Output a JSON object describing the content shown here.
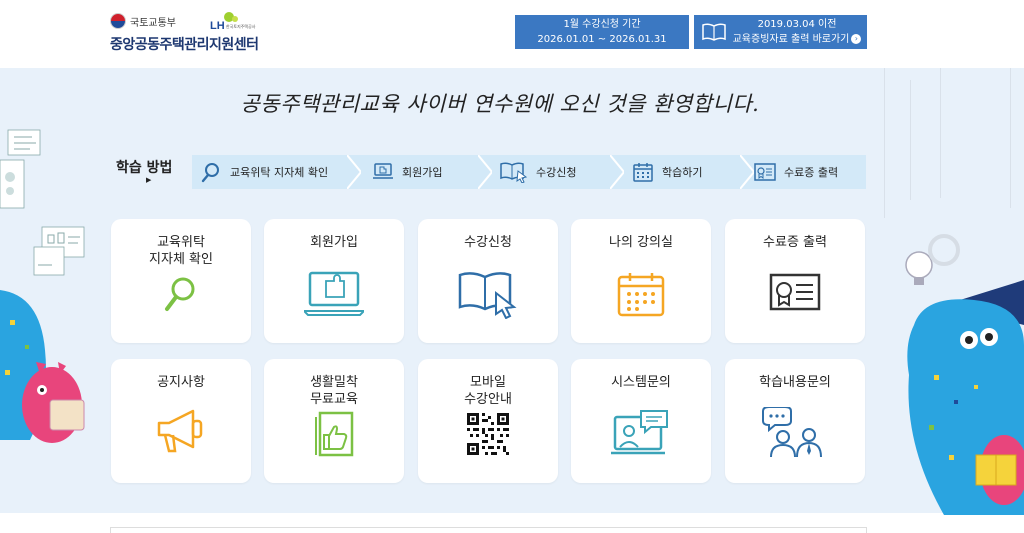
{
  "header": {
    "ministry": "국토교통부",
    "lh_logo": "LH",
    "lh_sub": "한국토지주택공사",
    "center_name": "중앙공동주택관리지원센터",
    "period_button": {
      "line1": "1월 수강신청 기간",
      "line2": "2026.01.01 ~ 2026.01.31"
    },
    "cert_button": {
      "line1": "2019.03.04 이전",
      "line2": "교육증빙자료 출력 바로가기",
      "icon": "book-icon"
    }
  },
  "welcome": "공동주택관리교육 사이버 연수원에 오신 것을 환영합니다.",
  "study": {
    "label": "학습 방법",
    "steps": [
      {
        "label": "교육위탁 지자체 확인",
        "icon": "search-icon"
      },
      {
        "label": "회원가입",
        "icon": "laptop-puzzle-icon"
      },
      {
        "label": "수강신청",
        "icon": "book-cursor-icon"
      },
      {
        "label": "학습하기",
        "icon": "calendar-icon"
      },
      {
        "label": "수료증 출력",
        "icon": "certificate-icon"
      }
    ]
  },
  "cards": [
    {
      "title": "교육위탁\n지자체 확인",
      "icon": "search-icon"
    },
    {
      "title": "회원가입",
      "icon": "laptop-puzzle-icon"
    },
    {
      "title": "수강신청",
      "icon": "book-cursor-icon"
    },
    {
      "title": "나의 강의실",
      "icon": "calendar-icon"
    },
    {
      "title": "수료증 출력",
      "icon": "certificate-icon"
    },
    {
      "title": "공지사항",
      "icon": "megaphone-icon"
    },
    {
      "title": "생활밀착\n무료교육",
      "icon": "book-thumbs-up-icon"
    },
    {
      "title": "모바일\n수강안내",
      "icon": "qr-code-icon"
    },
    {
      "title": "시스템문의",
      "icon": "monitor-chat-icon"
    },
    {
      "title": "학습내용문의",
      "icon": "people-chat-icon"
    }
  ],
  "colors": {
    "header_button": "#3b78c2",
    "main_bg": "#e8f1fa",
    "steps_bg": "#d3e9f8",
    "icon_blue": "#2f6ea8",
    "icon_green": "#7cc144",
    "icon_teal": "#3aa3b8",
    "icon_orange": "#f5a623"
  }
}
